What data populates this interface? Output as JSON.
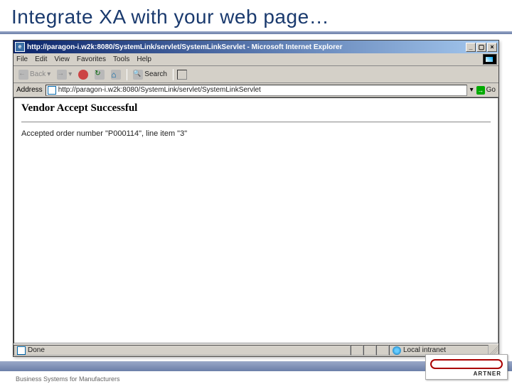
{
  "slide": {
    "title": "Integrate XA with your web page…",
    "footer_text": "Business Systems for Manufacturers"
  },
  "browser": {
    "window_title": "http://paragon-i.w2k:8080/SystemLink/servlet/SystemLinkServlet - Microsoft Internet Explorer",
    "menus": [
      "File",
      "Edit",
      "View",
      "Favorites",
      "Tools",
      "Help"
    ],
    "back_label": "Back",
    "search_label": "Search",
    "address_label": "Address",
    "address_value": "http://paragon-i.w2k:8080/SystemLink/servlet/SystemLinkServlet",
    "go_label": "Go",
    "status_text": "Done",
    "zone_text": "Local intranet"
  },
  "page": {
    "heading": "Vendor Accept Successful",
    "body": "Accepted order number \"P000114\", line item \"3\""
  },
  "logo": {
    "label": "ARTNER"
  }
}
